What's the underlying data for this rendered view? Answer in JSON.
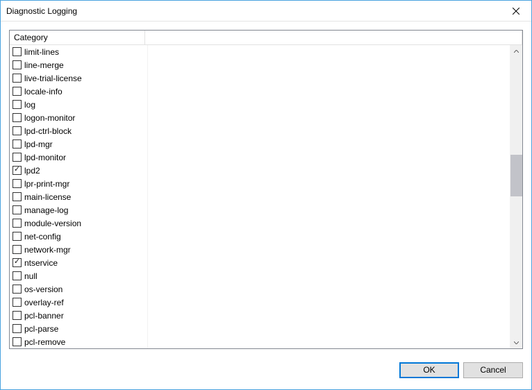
{
  "window": {
    "title": "Diagnostic Logging"
  },
  "header": {
    "category_label": "Category"
  },
  "categories": [
    {
      "label": "limit-lines",
      "checked": false
    },
    {
      "label": "line-merge",
      "checked": false
    },
    {
      "label": "live-trial-license",
      "checked": false
    },
    {
      "label": "locale-info",
      "checked": false
    },
    {
      "label": "log",
      "checked": false
    },
    {
      "label": "logon-monitor",
      "checked": false
    },
    {
      "label": "lpd-ctrl-block",
      "checked": false
    },
    {
      "label": "lpd-mgr",
      "checked": false
    },
    {
      "label": "lpd-monitor",
      "checked": false
    },
    {
      "label": "lpd2",
      "checked": true
    },
    {
      "label": "lpr-print-mgr",
      "checked": false
    },
    {
      "label": "main-license",
      "checked": false
    },
    {
      "label": "manage-log",
      "checked": false
    },
    {
      "label": "module-version",
      "checked": false
    },
    {
      "label": "net-config",
      "checked": false
    },
    {
      "label": "network-mgr",
      "checked": false
    },
    {
      "label": "ntservice",
      "checked": true
    },
    {
      "label": "null",
      "checked": false
    },
    {
      "label": "os-version",
      "checked": false
    },
    {
      "label": "overlay-ref",
      "checked": false
    },
    {
      "label": "pcl-banner",
      "checked": false
    },
    {
      "label": "pcl-parse",
      "checked": false
    },
    {
      "label": "pcl-remove",
      "checked": false
    }
  ],
  "buttons": {
    "ok": "OK",
    "cancel": "Cancel"
  }
}
